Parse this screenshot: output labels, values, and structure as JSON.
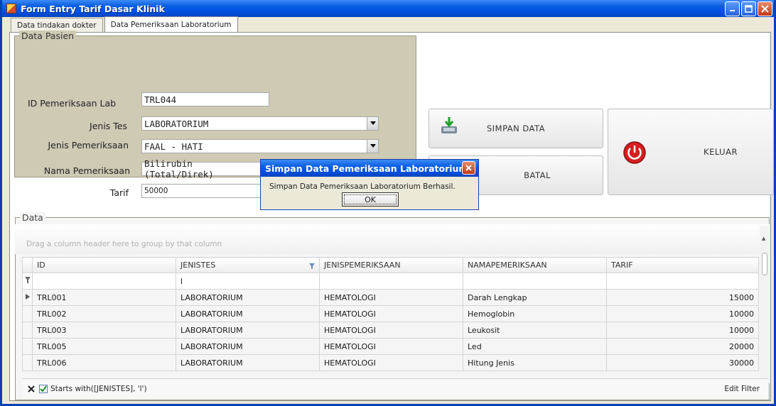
{
  "window": {
    "title": "Form Entry Tarif Dasar Klinik"
  },
  "tabs": [
    "Data tindakan dokter",
    "Data Pemeriksaan Laboratorium"
  ],
  "pasien": {
    "legend": "Data Pasien",
    "id_label": "ID Pemeriksaan Lab",
    "id_value": "TRL044",
    "jenis_tes_label": "Jenis Tes",
    "jenis_tes_value": "LABORATORIUM",
    "jenis_pemeriksaan_label": "Jenis Pemeriksaan",
    "jenis_pemeriksaan_value": "FAAL - HATI",
    "nama_label": "Nama Pemeriksaan",
    "nama_value": "Bilirubin (Total/Direk)",
    "tarif_label": "Tarif",
    "tarif_value": "50000"
  },
  "buttons": {
    "simpan": "SIMPAN DATA",
    "batal": "BATAL",
    "keluar": "KELUAR"
  },
  "data_group": {
    "legend": "Data",
    "group_hint": "Drag a column header here to group by that column",
    "columns": [
      "ID",
      "JENISTES",
      "JENISPEMERIKSAAN",
      "NAMAPEMERIKSAAN",
      "TARIF"
    ],
    "filter_row": [
      "",
      "l",
      "",
      "",
      ""
    ],
    "rows": [
      [
        "TRL001",
        "LABORATORIUM",
        "HEMATOLOGI",
        "Darah Lengkap",
        "15000"
      ],
      [
        "TRL002",
        "LABORATORIUM",
        "HEMATOLOGI",
        "Hemoglobin",
        "10000"
      ],
      [
        "TRL003",
        "LABORATORIUM",
        "HEMATOLOGI",
        "Leukosit",
        "10000"
      ],
      [
        "TRL005",
        "LABORATORIUM",
        "HEMATOLOGI",
        "Led",
        "20000"
      ],
      [
        "TRL006",
        "LABORATORIUM",
        "HEMATOLOGI",
        "Hitung Jenis",
        "30000"
      ]
    ],
    "filter_text": "Starts with([JENISTES], 'l')",
    "edit_filter": "Edit Filter"
  },
  "dialog": {
    "title": "Simpan Data Pemeriksaan Laboratorium",
    "message": "Simpan Data Pemeriksaan Laboratorium Berhasil.",
    "ok": "OK"
  },
  "colors": {
    "titlebar": "#0054e3",
    "group_bg": "#cfcab4",
    "keluar_icon": "#d42020"
  }
}
